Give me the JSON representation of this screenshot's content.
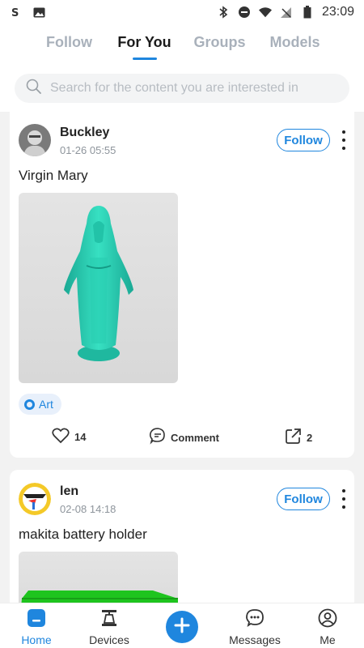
{
  "status_bar": {
    "time": "23:09"
  },
  "tabs": [
    {
      "label": "Follow"
    },
    {
      "label": "For You"
    },
    {
      "label": "Groups"
    },
    {
      "label": "Models"
    }
  ],
  "search": {
    "placeholder": "Search for the content you are interested in"
  },
  "posts": [
    {
      "author": "Buckley",
      "date": "01-26 05:55",
      "follow_label": "Follow",
      "title": "Virgin Mary",
      "tag": "Art",
      "likes": "14",
      "comment_label": "Comment",
      "shares": "2"
    },
    {
      "author": "len",
      "date": "02-08 14:18",
      "follow_label": "Follow",
      "title": "makita battery holder"
    }
  ],
  "bottom_nav": [
    {
      "label": "Home",
      "icon": "home-icon"
    },
    {
      "label": "Devices",
      "icon": "devices-icon"
    },
    {
      "label": "",
      "icon": "plus-icon"
    },
    {
      "label": "Messages",
      "icon": "messages-icon"
    },
    {
      "label": "Me",
      "icon": "profile-icon"
    }
  ],
  "colors": {
    "accent": "#1f86de",
    "statue": "#2fd6b9",
    "model_green": "#1ec41e"
  }
}
